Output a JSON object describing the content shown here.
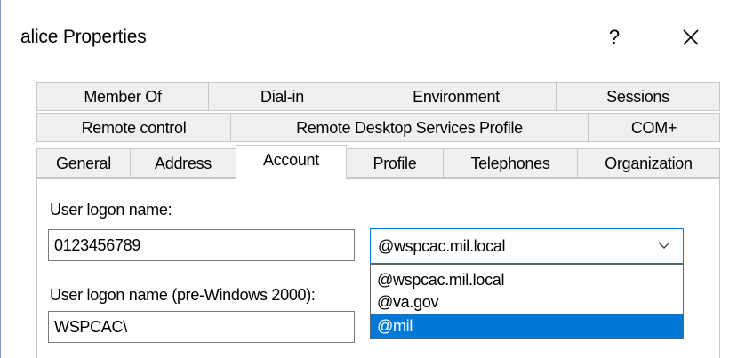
{
  "window": {
    "title": "alice Properties",
    "help_label": "?"
  },
  "tabs": {
    "row1": [
      "Member Of",
      "Dial-in",
      "Environment",
      "Sessions"
    ],
    "row2": [
      "Remote control",
      "Remote Desktop Services Profile",
      "COM+"
    ],
    "row3": [
      "General",
      "Address",
      "Account",
      "Profile",
      "Telephones",
      "Organization"
    ],
    "active": "Account"
  },
  "account": {
    "logon_name_label": "User logon name:",
    "logon_name_value": "0123456789",
    "domain_selected": "@wspcac.mil.local",
    "domain_options": [
      "@wspcac.mil.local",
      "@va.gov",
      "@mil"
    ],
    "domain_highlighted": "@mil",
    "pre2000_label": "User logon name (pre-Windows 2000):",
    "pre2000_domain_value": "WSPCAC\\"
  },
  "colors": {
    "accent": "#0078d7",
    "tab_bg": "#f0f0f0",
    "border": "#c8c8c8"
  }
}
